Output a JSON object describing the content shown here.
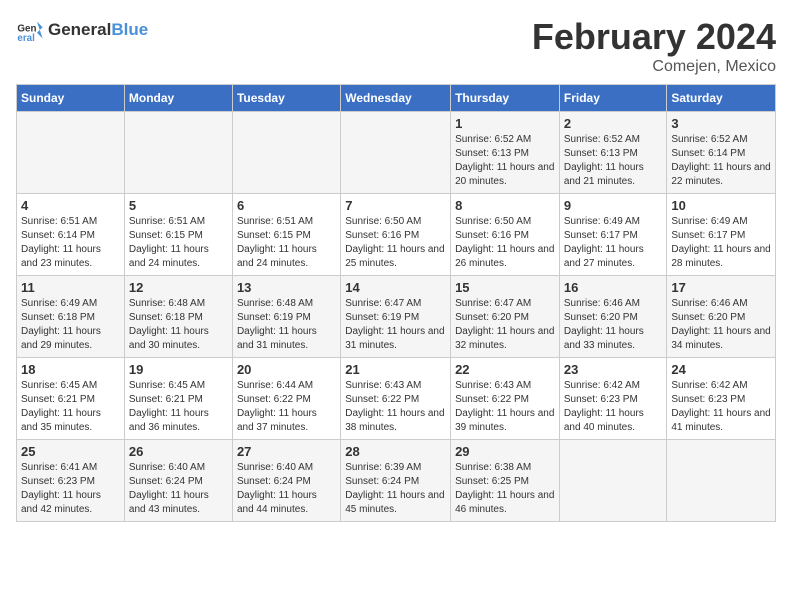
{
  "header": {
    "logo_general": "General",
    "logo_blue": "Blue",
    "month_year": "February 2024",
    "location": "Comejen, Mexico"
  },
  "days_of_week": [
    "Sunday",
    "Monday",
    "Tuesday",
    "Wednesday",
    "Thursday",
    "Friday",
    "Saturday"
  ],
  "weeks": [
    [
      {
        "day": "",
        "empty": true
      },
      {
        "day": "",
        "empty": true
      },
      {
        "day": "",
        "empty": true
      },
      {
        "day": "",
        "empty": true
      },
      {
        "day": "1",
        "sunrise": "6:52 AM",
        "sunset": "6:13 PM",
        "daylight": "11 hours and 20 minutes."
      },
      {
        "day": "2",
        "sunrise": "6:52 AM",
        "sunset": "6:13 PM",
        "daylight": "11 hours and 21 minutes."
      },
      {
        "day": "3",
        "sunrise": "6:52 AM",
        "sunset": "6:14 PM",
        "daylight": "11 hours and 22 minutes."
      }
    ],
    [
      {
        "day": "4",
        "sunrise": "6:51 AM",
        "sunset": "6:14 PM",
        "daylight": "11 hours and 23 minutes."
      },
      {
        "day": "5",
        "sunrise": "6:51 AM",
        "sunset": "6:15 PM",
        "daylight": "11 hours and 24 minutes."
      },
      {
        "day": "6",
        "sunrise": "6:51 AM",
        "sunset": "6:15 PM",
        "daylight": "11 hours and 24 minutes."
      },
      {
        "day": "7",
        "sunrise": "6:50 AM",
        "sunset": "6:16 PM",
        "daylight": "11 hours and 25 minutes."
      },
      {
        "day": "8",
        "sunrise": "6:50 AM",
        "sunset": "6:16 PM",
        "daylight": "11 hours and 26 minutes."
      },
      {
        "day": "9",
        "sunrise": "6:49 AM",
        "sunset": "6:17 PM",
        "daylight": "11 hours and 27 minutes."
      },
      {
        "day": "10",
        "sunrise": "6:49 AM",
        "sunset": "6:17 PM",
        "daylight": "11 hours and 28 minutes."
      }
    ],
    [
      {
        "day": "11",
        "sunrise": "6:49 AM",
        "sunset": "6:18 PM",
        "daylight": "11 hours and 29 minutes."
      },
      {
        "day": "12",
        "sunrise": "6:48 AM",
        "sunset": "6:18 PM",
        "daylight": "11 hours and 30 minutes."
      },
      {
        "day": "13",
        "sunrise": "6:48 AM",
        "sunset": "6:19 PM",
        "daylight": "11 hours and 31 minutes."
      },
      {
        "day": "14",
        "sunrise": "6:47 AM",
        "sunset": "6:19 PM",
        "daylight": "11 hours and 31 minutes."
      },
      {
        "day": "15",
        "sunrise": "6:47 AM",
        "sunset": "6:20 PM",
        "daylight": "11 hours and 32 minutes."
      },
      {
        "day": "16",
        "sunrise": "6:46 AM",
        "sunset": "6:20 PM",
        "daylight": "11 hours and 33 minutes."
      },
      {
        "day": "17",
        "sunrise": "6:46 AM",
        "sunset": "6:20 PM",
        "daylight": "11 hours and 34 minutes."
      }
    ],
    [
      {
        "day": "18",
        "sunrise": "6:45 AM",
        "sunset": "6:21 PM",
        "daylight": "11 hours and 35 minutes."
      },
      {
        "day": "19",
        "sunrise": "6:45 AM",
        "sunset": "6:21 PM",
        "daylight": "11 hours and 36 minutes."
      },
      {
        "day": "20",
        "sunrise": "6:44 AM",
        "sunset": "6:22 PM",
        "daylight": "11 hours and 37 minutes."
      },
      {
        "day": "21",
        "sunrise": "6:43 AM",
        "sunset": "6:22 PM",
        "daylight": "11 hours and 38 minutes."
      },
      {
        "day": "22",
        "sunrise": "6:43 AM",
        "sunset": "6:22 PM",
        "daylight": "11 hours and 39 minutes."
      },
      {
        "day": "23",
        "sunrise": "6:42 AM",
        "sunset": "6:23 PM",
        "daylight": "11 hours and 40 minutes."
      },
      {
        "day": "24",
        "sunrise": "6:42 AM",
        "sunset": "6:23 PM",
        "daylight": "11 hours and 41 minutes."
      }
    ],
    [
      {
        "day": "25",
        "sunrise": "6:41 AM",
        "sunset": "6:23 PM",
        "daylight": "11 hours and 42 minutes."
      },
      {
        "day": "26",
        "sunrise": "6:40 AM",
        "sunset": "6:24 PM",
        "daylight": "11 hours and 43 minutes."
      },
      {
        "day": "27",
        "sunrise": "6:40 AM",
        "sunset": "6:24 PM",
        "daylight": "11 hours and 44 minutes."
      },
      {
        "day": "28",
        "sunrise": "6:39 AM",
        "sunset": "6:24 PM",
        "daylight": "11 hours and 45 minutes."
      },
      {
        "day": "29",
        "sunrise": "6:38 AM",
        "sunset": "6:25 PM",
        "daylight": "11 hours and 46 minutes."
      },
      {
        "day": "",
        "empty": true
      },
      {
        "day": "",
        "empty": true
      }
    ]
  ]
}
